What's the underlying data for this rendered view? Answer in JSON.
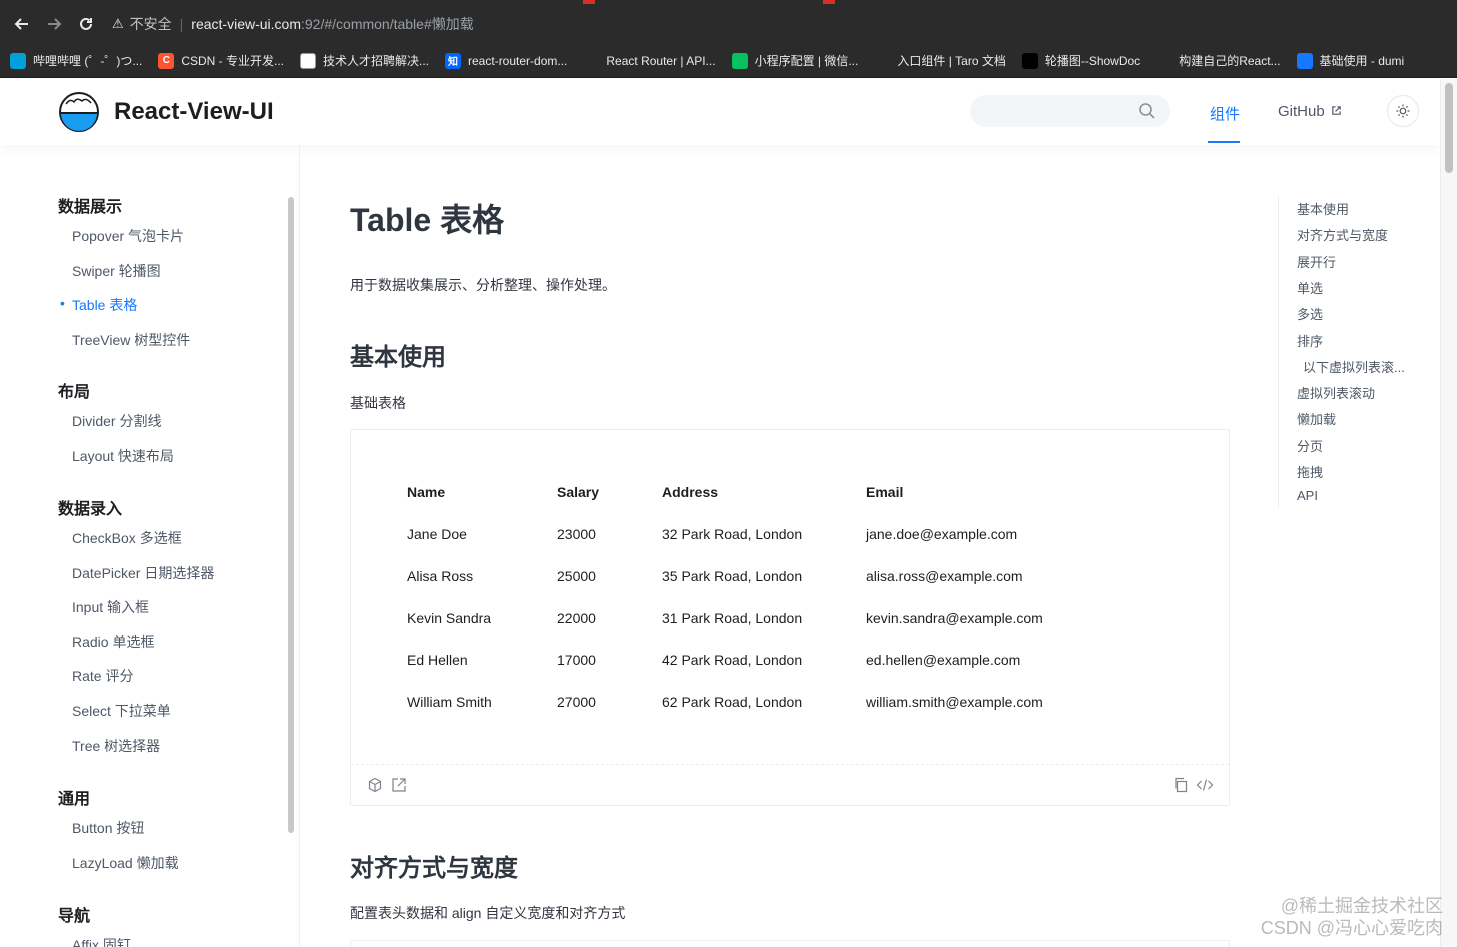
{
  "browser": {
    "insecure_label": "不安全",
    "url_host": "react-view-ui.com",
    "url_rest": ":92/#/common/table#懒加载",
    "bookmarks": [
      {
        "label": "哔哩哔哩 (゜-゜)つ...",
        "color": "#00a1d6",
        "glyph": ""
      },
      {
        "label": "CSDN - 专业开发...",
        "color": "#fc5531",
        "glyph": "C"
      },
      {
        "label": "技术人才招聘解决...",
        "color": "#ffffff",
        "glyph": ""
      },
      {
        "label": "react-router-dom...",
        "color": "#0066ff",
        "glyph": "知"
      },
      {
        "label": "React Router | API...",
        "color": "#2b2b2b",
        "glyph": ""
      },
      {
        "label": "小程序配置 | 微信...",
        "color": "#07c160",
        "glyph": ""
      },
      {
        "label": "入口组件 | Taro 文档",
        "color": "#2b2b2b",
        "glyph": ""
      },
      {
        "label": "轮播图--ShowDoc",
        "color": "#000000",
        "glyph": ""
      },
      {
        "label": "构建自己的React...",
        "color": "#2b2b2b",
        "glyph": ""
      },
      {
        "label": "基础使用 - dumi",
        "color": "#1677ff",
        "glyph": ""
      }
    ]
  },
  "header": {
    "brand": "React-View-UI",
    "nav_components": "组件",
    "nav_github": "GitHub",
    "accent": "#1677ff"
  },
  "sidebar": {
    "groups": [
      {
        "title": "数据展示",
        "items": [
          "Popover 气泡卡片",
          "Swiper 轮播图",
          "Table 表格",
          "TreeView 树型控件"
        ]
      },
      {
        "title": "布局",
        "items": [
          "Divider 分割线",
          "Layout 快速布局"
        ]
      },
      {
        "title": "数据录入",
        "items": [
          "CheckBox 多选框",
          "DatePicker 日期选择器",
          "Input 输入框",
          "Radio 单选框",
          "Rate 评分",
          "Select 下拉菜单",
          "Tree 树选择器"
        ]
      },
      {
        "title": "通用",
        "items": [
          "Button 按钮",
          "LazyLoad 懒加载"
        ]
      },
      {
        "title": "导航",
        "items": [
          "Affix 固钉"
        ]
      }
    ],
    "active_item": "Table 表格"
  },
  "main": {
    "title": "Table 表格",
    "description": "用于数据收集展示、分析整理、操作处理。",
    "section1_title": "基本使用",
    "section1_desc": "基础表格",
    "table": {
      "columns": [
        "Name",
        "Salary",
        "Address",
        "Email"
      ],
      "rows": [
        [
          "Jane Doe",
          "23000",
          "32 Park Road, London",
          "jane.doe@example.com"
        ],
        [
          "Alisa Ross",
          "25000",
          "35 Park Road, London",
          "alisa.ross@example.com"
        ],
        [
          "Kevin Sandra",
          "22000",
          "31 Park Road, London",
          "kevin.sandra@example.com"
        ],
        [
          "Ed Hellen",
          "17000",
          "42 Park Road, London",
          "ed.hellen@example.com"
        ],
        [
          "William Smith",
          "27000",
          "62 Park Road, London",
          "william.smith@example.com"
        ]
      ]
    },
    "section2_title": "对齐方式与宽度",
    "section2_desc": "配置表头数据和 align 自定义宽度和对齐方式"
  },
  "toc": [
    "基本使用",
    "对齐方式与宽度",
    "展开行",
    "单选",
    "多选",
    "排序",
    "以下虚拟列表滚...",
    "虚拟列表滚动",
    "懒加载",
    "分页",
    "拖拽",
    "API"
  ],
  "watermark": {
    "line1": "@稀土掘金技术社区",
    "line2": "CSDN @冯心心爱吃肉"
  }
}
